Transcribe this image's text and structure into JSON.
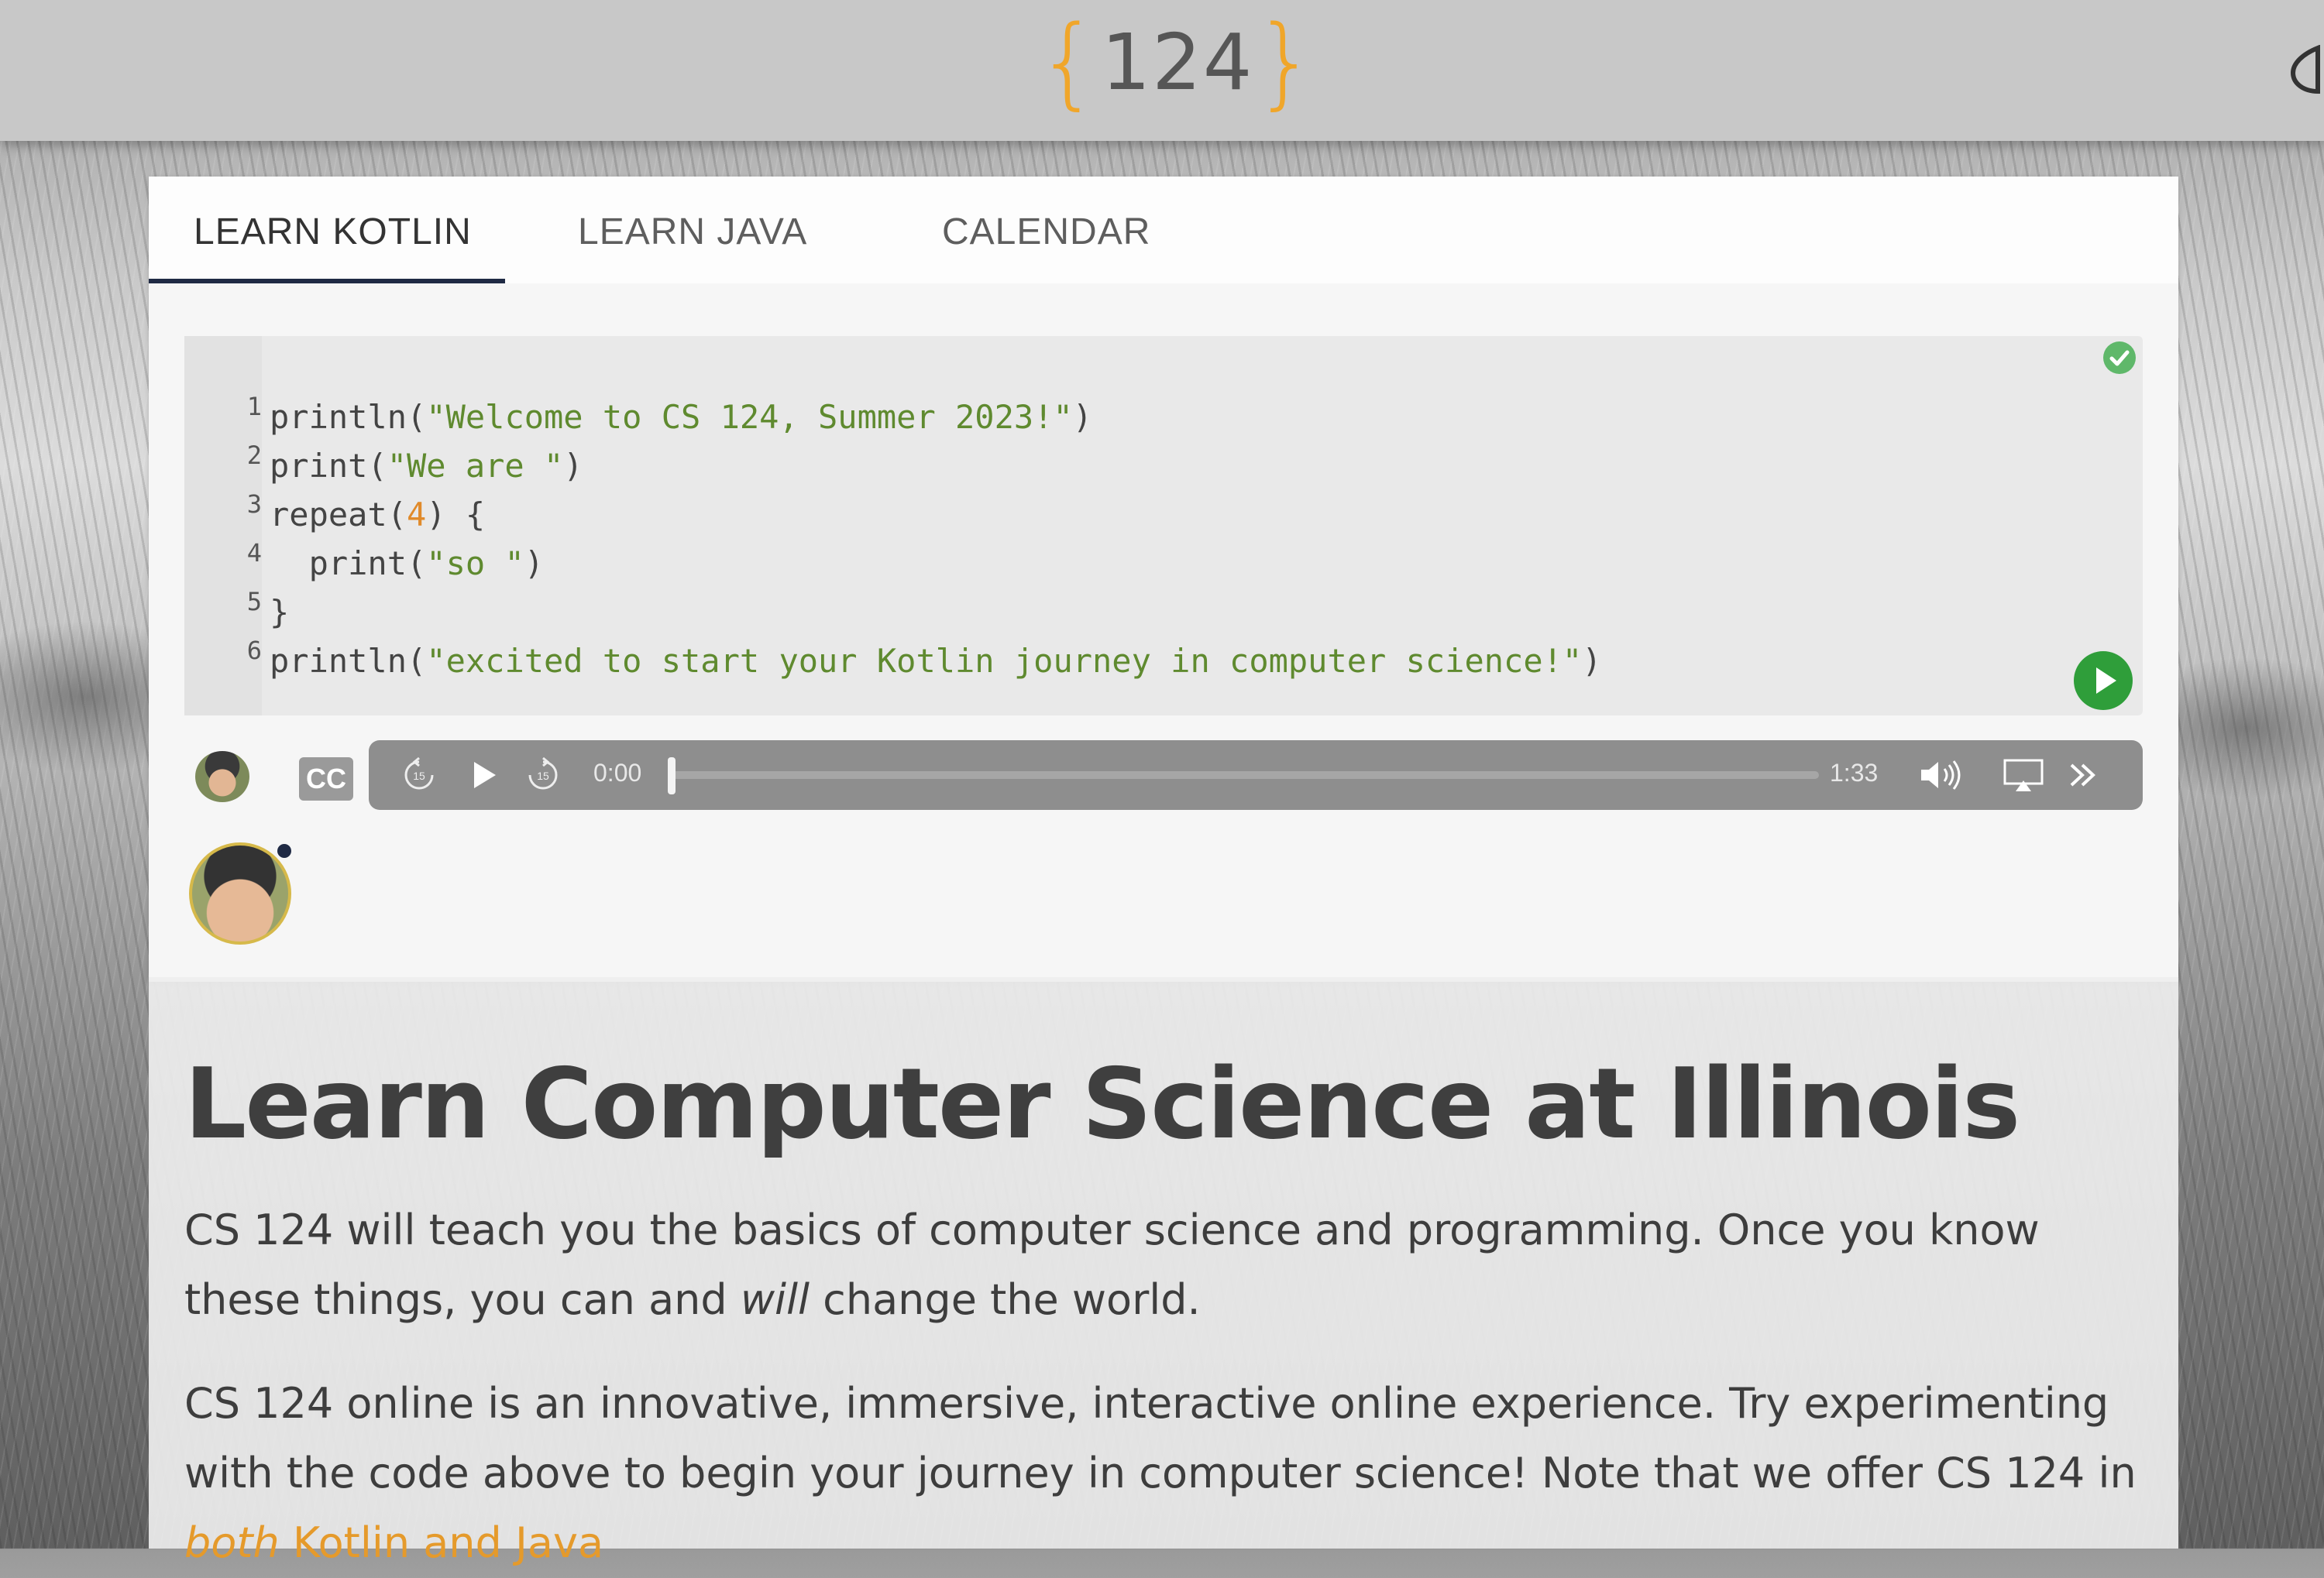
{
  "header": {
    "logo_text": "124",
    "logo_brace_left": "{",
    "logo_brace_right": "}",
    "accent_color": "#f0a62a",
    "theme_toggle_icon": "contrast-icon"
  },
  "tabs": [
    {
      "label": "LEARN KOTLIN",
      "active": true
    },
    {
      "label": "LEARN JAVA",
      "active": false
    },
    {
      "label": "CALENDAR",
      "active": false
    }
  ],
  "editor": {
    "lines": [
      {
        "num": "1",
        "parts": [
          {
            "t": "println(",
            "c": ""
          },
          {
            "t": "\"Welcome to CS 124, Summer 2023!\"",
            "c": "str"
          },
          {
            "t": ")",
            "c": ""
          }
        ]
      },
      {
        "num": "2",
        "parts": [
          {
            "t": "print(",
            "c": ""
          },
          {
            "t": "\"We are \"",
            "c": "str"
          },
          {
            "t": ")",
            "c": ""
          }
        ]
      },
      {
        "num": "3",
        "parts": [
          {
            "t": "repeat(",
            "c": ""
          },
          {
            "t": "4",
            "c": "num"
          },
          {
            "t": ") {",
            "c": ""
          }
        ]
      },
      {
        "num": "4",
        "parts": [
          {
            "t": "  print(",
            "c": ""
          },
          {
            "t": "\"so \"",
            "c": "str"
          },
          {
            "t": ")",
            "c": ""
          }
        ]
      },
      {
        "num": "5",
        "parts": [
          {
            "t": "}",
            "c": ""
          }
        ]
      },
      {
        "num": "6",
        "parts": [
          {
            "t": "println(",
            "c": ""
          },
          {
            "t": "\"excited to start your Kotlin journey in computer science!\"",
            "c": "str"
          },
          {
            "t": ")",
            "c": ""
          }
        ]
      }
    ],
    "status_icon": "check-circle-icon",
    "run_icon": "play-circle-icon"
  },
  "player": {
    "cc_label": "CC",
    "current_time": "0:00",
    "duration": "1:33",
    "progress": 0.0,
    "skip_back_label": "15",
    "skip_forward_label": "15"
  },
  "content": {
    "headline": "Learn Computer Science at Illinois",
    "para1_before": "CS 124 will teach you the basics of computer science and programming. Once you know these things, you can and ",
    "para1_em": "will",
    "para1_after": " change the world.",
    "para2": "CS 124 online is an innovative, immersive, interactive online experience. Try experimenting with the code above to begin your journey in computer science! Note that we offer CS 124 in ",
    "para2_link_em": "both",
    "para2_link": " Kotlin and Java"
  }
}
